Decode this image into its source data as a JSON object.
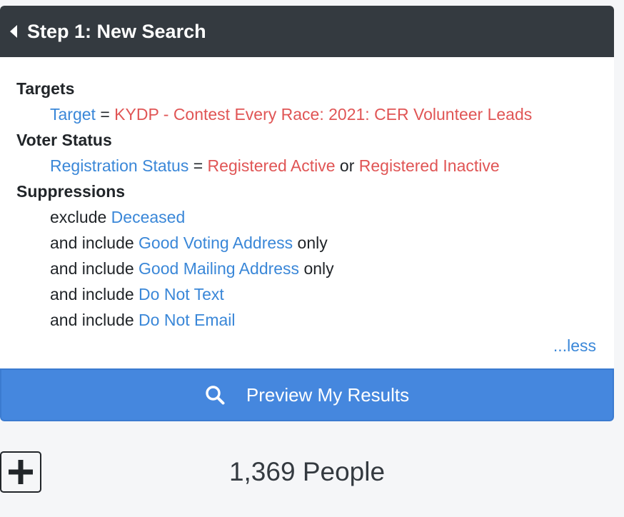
{
  "header": {
    "title": "Step 1: New Search"
  },
  "criteria": {
    "targets_title": "Targets",
    "target_field": "Target",
    "eq1": "=",
    "target_value": "KYDP - Contest Every Race: 2021: CER Volunteer Leads",
    "voter_status_title": "Voter Status",
    "reg_field": "Registration Status",
    "eq2": "=",
    "reg_value1": "Registered Active",
    "or": "or",
    "reg_value2": "Registered Inactive",
    "suppressions_title": "Suppressions",
    "suppressions": [
      {
        "prefix": "exclude",
        "link": "Deceased",
        "suffix": ""
      },
      {
        "prefix": "and include",
        "link": "Good Voting Address",
        "suffix": "only"
      },
      {
        "prefix": "and include",
        "link": "Good Mailing Address",
        "suffix": "only"
      },
      {
        "prefix": "and include",
        "link": "Do Not Text",
        "suffix": ""
      },
      {
        "prefix": "and include",
        "link": "Do Not Email",
        "suffix": ""
      }
    ],
    "less_link": "...less"
  },
  "preview": {
    "label": "Preview My Results",
    "icon": "search-icon"
  },
  "footer": {
    "count": "1,369 People",
    "add_icon": "plus-icon"
  },
  "colors": {
    "header_bg": "#343a40",
    "link": "#3a87d8",
    "value": "#e05555",
    "button": "#4587de"
  }
}
